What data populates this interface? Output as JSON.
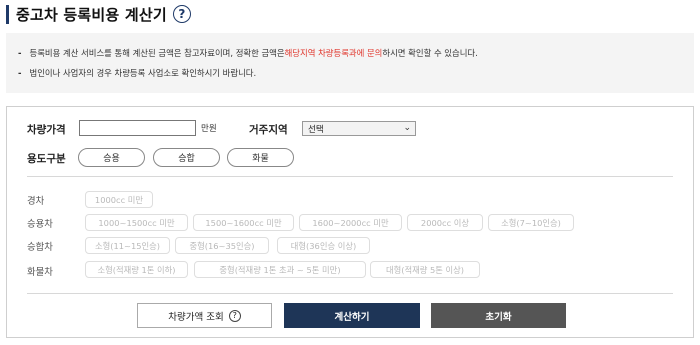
{
  "header": {
    "title": "중고차 등록비용 계산기",
    "help_icon": "?"
  },
  "notice": {
    "line1_prefix": "등록비용 계산 서비스를 통해 계산된 금액은 참고자료이며, 정확한 금액은 ",
    "line1_highlight": "해당지역 차량등록과에 문의",
    "line1_suffix": "하시면 확인할 수 있습니다.",
    "line2": "법인이나 사업자의 경우 차량등록 사업소로 확인하시기 바랍니다.",
    "bullet": "-",
    "highlight_color": "#e0342a"
  },
  "form": {
    "price_label": "차량가격",
    "price_value": "",
    "price_unit": "만원",
    "region_label": "거주지역",
    "region_selected": "선택",
    "usage_label": "용도구분",
    "usage_options": [
      "승용",
      "승합",
      "화물"
    ]
  },
  "categories": {
    "light": {
      "label": "경차",
      "options": [
        "1000cc 미만"
      ]
    },
    "passenger": {
      "label": "승용차",
      "options": [
        "1000~1500cc 미만",
        "1500~1600cc 미만",
        "1600~2000cc 미만",
        "2000cc 이상",
        "소형(7~10인승)"
      ]
    },
    "van": {
      "label": "승합차",
      "options": [
        "소형(11~15인승)",
        "중형(16~35인승)",
        "대형(36인승 이상)"
      ]
    },
    "truck": {
      "label": "화물차",
      "options": [
        "소형(적재량 1톤 이하)",
        "중형(적재량 1톤 초과 ~ 5톤 미만)",
        "대형(적재량 5톤 이상)"
      ]
    }
  },
  "buttons": {
    "lookup": "차량가액 조회",
    "lookup_help": "?",
    "calculate": "계산하기",
    "reset": "초기화"
  },
  "colors": {
    "primary": "#1e3557",
    "reset": "#555555"
  }
}
